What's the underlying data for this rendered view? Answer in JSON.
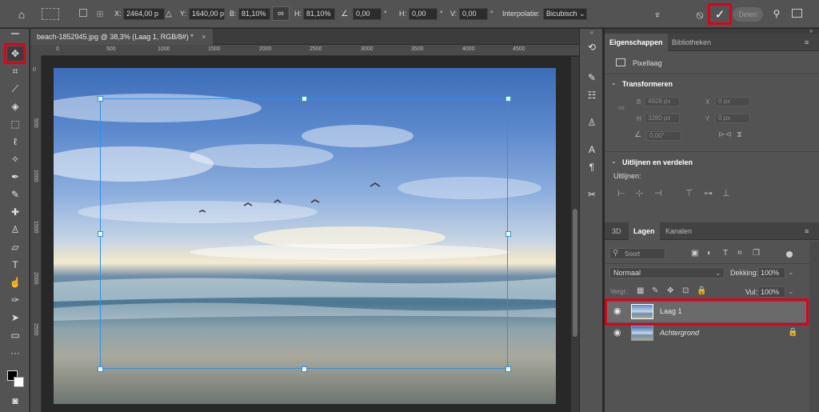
{
  "options_bar": {
    "x_label": "X:",
    "x_value": "2464,00 p",
    "y_label": "Y:",
    "y_value": "1640,00 p",
    "w_label": "B:",
    "w_value": "81,10%",
    "h_label": "H:",
    "h_value": "81,10%",
    "angle_value": "0,00",
    "deg": "°",
    "skew_h_label": "H:",
    "skew_h_value": "0,00",
    "skew_v_label": "V:",
    "skew_v_value": "0,00",
    "interp_label": "Interpolatie:",
    "interp_value": "Bicubisch",
    "share_label": "Delen"
  },
  "document": {
    "tab_title": "beach-1852945.jpg @ 38,3% (Laag 1, RGB/8#) *",
    "close_glyph": "×",
    "h_ruler": [
      "0",
      "500",
      "1000",
      "1500",
      "2000",
      "2500",
      "3000",
      "3500",
      "4000",
      "4500"
    ],
    "v_ruler": [
      "0",
      "500",
      "1000",
      "1500",
      "2000",
      "2500"
    ]
  },
  "properties_panel": {
    "tabs": [
      "Eigenschappen",
      "Bibliotheken"
    ],
    "layer_type": "Pixellaag",
    "transform_title": "Transformeren",
    "w_label": "B",
    "w_value": "4928 px",
    "h_label": "H",
    "h_value": "3280 px",
    "x_label": "X",
    "x_value": "0 px",
    "y_label": "Y",
    "y_value": "0 px",
    "angle_value": "0,00°",
    "align_title": "Uitlijnen en verdelen",
    "align_sub": "Uitlijnen:"
  },
  "layers_panel": {
    "tabs": [
      "3D",
      "Lagen",
      "Kanalen"
    ],
    "filter_label": "Soort",
    "blend_mode": "Normaal",
    "opacity_label": "Dekking:",
    "opacity_value": "100%",
    "lock_label": "Vergr.:",
    "fill_label": "Vul:",
    "fill_value": "100%",
    "layers": [
      {
        "name": "Laag 1",
        "selected": true
      },
      {
        "name": "Achtergrond",
        "selected": false,
        "locked": true
      }
    ]
  },
  "colors": {
    "accent_highlight": "#e1001a",
    "transform_box": "#2f8fe8"
  }
}
